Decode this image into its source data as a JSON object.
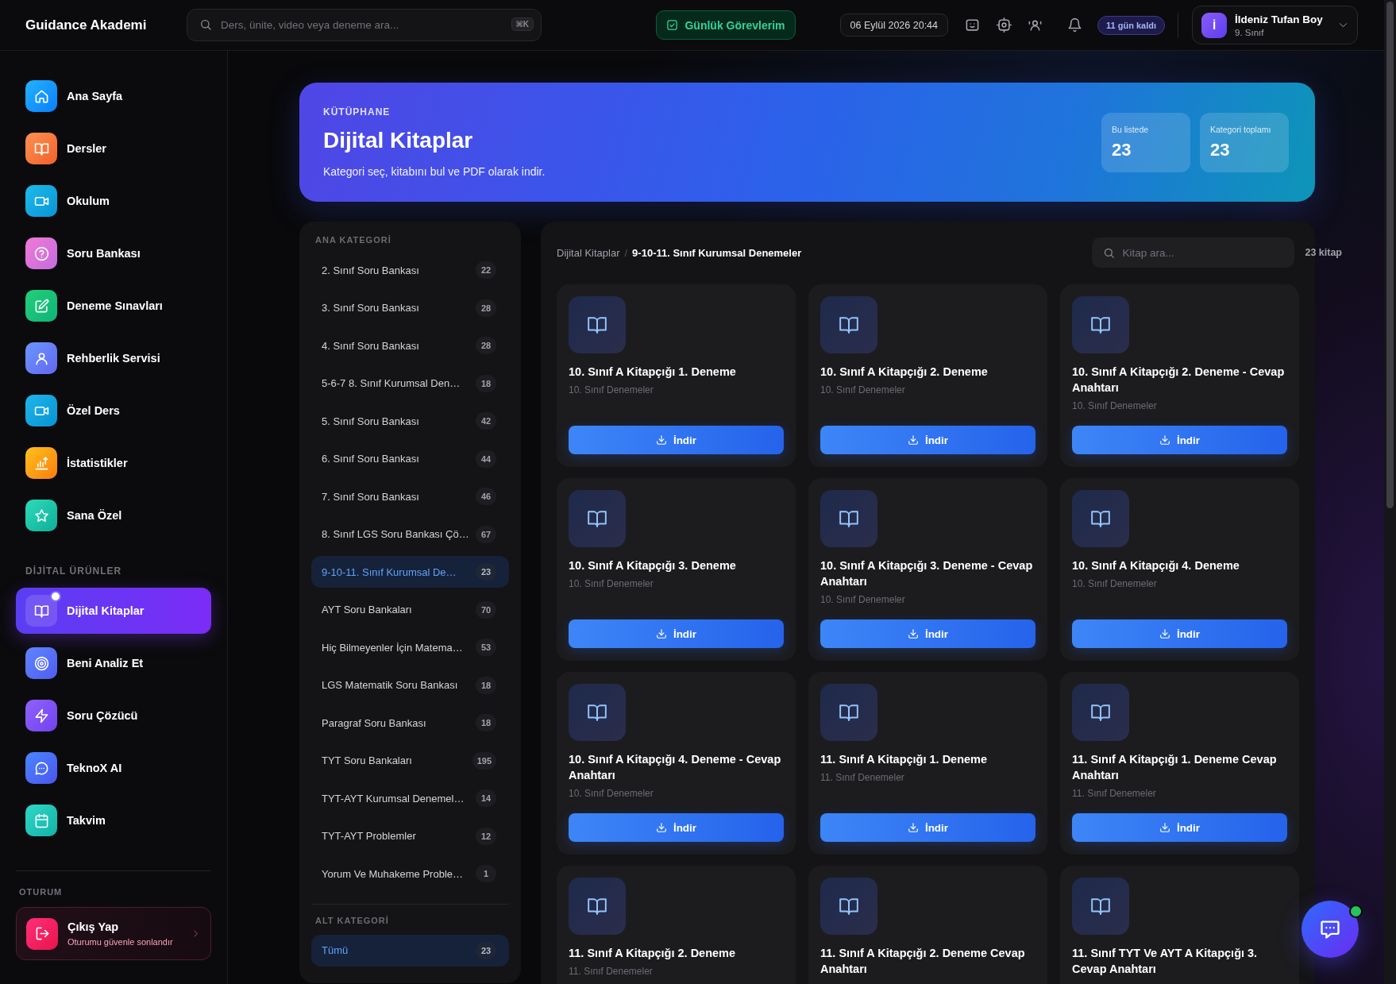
{
  "topbar": {
    "brand": "Guidance Akademi",
    "search": {
      "placeholder": "Ders, ünite, video veya deneme ara...",
      "shortcut": "⌘K"
    },
    "tasks_button": "Günlük Görevlerim",
    "datetime": "06 Eylül 2026 20:44",
    "countdown_badge": "11 gün kaldı",
    "user": {
      "initial": "İ",
      "name": "İldeniz Tufan Boy",
      "grade": "9. Sınıf"
    }
  },
  "sidebar": {
    "sections": [
      {
        "items": [
          {
            "label": "Ana Sayfa",
            "selected": false
          },
          {
            "label": "Dersler",
            "selected": false
          },
          {
            "label": "Okulum",
            "selected": false
          },
          {
            "label": "Soru Bankası",
            "selected": false
          },
          {
            "label": "Deneme Sınavları",
            "selected": false
          },
          {
            "label": "Rehberlik Servisi",
            "selected": false
          },
          {
            "label": "Özel Ders",
            "selected": false
          },
          {
            "label": "İstatistikler",
            "selected": false
          },
          {
            "label": "Sana Özel",
            "selected": false
          }
        ]
      },
      {
        "title": "DİJİTAL ÜRÜNLER",
        "items": [
          {
            "label": "Dijital Kitaplar",
            "selected": true
          },
          {
            "label": "Beni Analiz Et",
            "selected": false
          },
          {
            "label": "Soru Çözücü",
            "selected": false
          },
          {
            "label": "TeknoX AI",
            "selected": false
          },
          {
            "label": "Takvim",
            "selected": false
          }
        ]
      }
    ],
    "session": {
      "title": "OTURUM",
      "logout": {
        "label": "Çıkış Yap",
        "description": "Oturumu güvenle sonlandır"
      }
    }
  },
  "hero": {
    "eyebrow": "KÜTÜPHANE",
    "title": "Dijital Kitaplar",
    "subtitle": "Kategori seç, kitabını bul ve PDF olarak indir.",
    "stats": [
      {
        "label": "Bu listede",
        "value": "23"
      },
      {
        "label": "Kategori toplamı",
        "value": "23"
      }
    ]
  },
  "categories": {
    "main_title": "ANA KATEGORİ",
    "main": [
      {
        "label": "2. Sınıf Soru Bankası",
        "count": "22",
        "selected": false
      },
      {
        "label": "3. Sınıf Soru Bankası",
        "count": "28",
        "selected": false
      },
      {
        "label": "4. Sınıf Soru Bankası",
        "count": "28",
        "selected": false
      },
      {
        "label": "5-6-7 8. Sınıf Kurumsal Den…",
        "count": "18",
        "selected": false
      },
      {
        "label": "5. Sınıf Soru Bankası",
        "count": "42",
        "selected": false
      },
      {
        "label": "6. Sınıf Soru Bankası",
        "count": "44",
        "selected": false
      },
      {
        "label": "7. Sınıf Soru Bankası",
        "count": "46",
        "selected": false
      },
      {
        "label": "8. Sınıf LGS Soru Bankası Çö…",
        "count": "67",
        "selected": false
      },
      {
        "label": "9-10-11. Sınıf Kurumsal De…",
        "count": "23",
        "selected": true
      },
      {
        "label": "AYT Soru Bankaları",
        "count": "70",
        "selected": false
      },
      {
        "label": "Hiç Bilmeyenler İçin Matema…",
        "count": "53",
        "selected": false
      },
      {
        "label": "LGS Matematik Soru Bankası",
        "count": "18",
        "selected": false
      },
      {
        "label": "Paragraf Soru Bankası",
        "count": "18",
        "selected": false
      },
      {
        "label": "TYT Soru Bankaları",
        "count": "195",
        "selected": false
      },
      {
        "label": "TYT-AYT Kurumsal Denemel…",
        "count": "14",
        "selected": false
      },
      {
        "label": "TYT-AYT Problemler",
        "count": "12",
        "selected": false
      },
      {
        "label": "Yorum Ve Muhakeme Proble…",
        "count": "1",
        "selected": false
      }
    ],
    "sub_title": "ALT KATEGORİ",
    "sub": [
      {
        "label": "Tümü",
        "count": "23",
        "selected": true
      }
    ]
  },
  "library": {
    "breadcrumb": {
      "items": [
        "Dijital Kitaplar",
        "9-10-11. Sınıf Kurumsal Denemeler"
      ],
      "separator": "/"
    },
    "search_placeholder": "Kitap ara...",
    "count": "23 kitap",
    "books": [
      {
        "title": "10. Sınıf A Kitapçığı 1. Deneme",
        "category": "10. Sınıf Denemeler",
        "button": "İndir"
      },
      {
        "title": "10. Sınıf A Kitapçığı 2. Deneme",
        "category": "10. Sınıf Denemeler",
        "button": "İndir"
      },
      {
        "title": "10. Sınıf A Kitapçığı 2. Deneme - Cevap Anahtarı",
        "category": "10. Sınıf Denemeler",
        "button": "İndir"
      },
      {
        "title": "10. Sınıf A Kitapçığı 3. Deneme",
        "category": "10. Sınıf Denemeler",
        "button": "İndir"
      },
      {
        "title": "10. Sınıf A Kitapçığı 3. Deneme - Cevap Anahtarı",
        "category": "10. Sınıf Denemeler",
        "button": "İndir"
      },
      {
        "title": "10. Sınıf A Kitapçığı 4. Deneme",
        "category": "10. Sınıf Denemeler",
        "button": "İndir"
      },
      {
        "title": "10. Sınıf A Kitapçığı 4. Deneme - Cevap Anahtarı",
        "category": "10. Sınıf Denemeler",
        "button": "İndir"
      },
      {
        "title": "11. Sınıf A Kitapçığı 1. Deneme",
        "category": "11. Sınıf Denemeler",
        "button": "İndir"
      },
      {
        "title": "11. Sınıf A Kitapçığı 1. Deneme Cevap Anahtarı",
        "category": "11. Sınıf Denemeler",
        "button": "İndir"
      },
      {
        "title": "11. Sınıf A Kitapçığı 2. Deneme",
        "category": "11. Sınıf Denemeler"
      },
      {
        "title": "11. Sınıf A Kitapçığı 2. Deneme Cevap Anahtarı"
      },
      {
        "title": "11. Sınıf TYT Ve AYT A Kitapçığı 3. Cevap Anahtarı"
      }
    ]
  },
  "chat_button": {
    "online": true
  }
}
